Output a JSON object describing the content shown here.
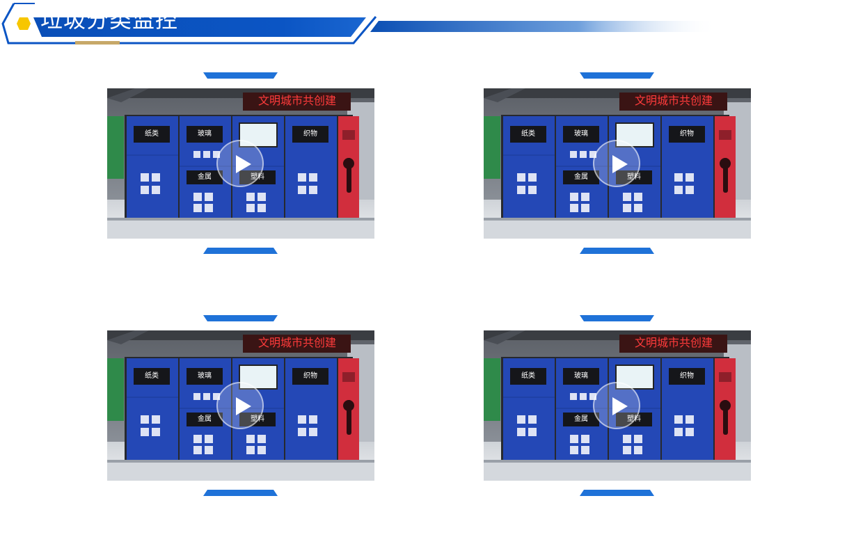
{
  "header": {
    "title": "垃圾分类监控",
    "accent_color": "#0f59c8",
    "dot_color": "#f7c600"
  },
  "videos": [
    {
      "sign": "文明城市共创建",
      "bins": [
        "纸类",
        "玻璃",
        "金属",
        "塑料",
        "织物"
      ]
    },
    {
      "sign": "文明城市共创建",
      "bins": [
        "纸类",
        "玻璃",
        "金属",
        "塑料",
        "织物"
      ]
    },
    {
      "sign": "文明城市共创建",
      "bins": [
        "纸类",
        "玻璃",
        "金属",
        "塑料",
        "织物"
      ]
    },
    {
      "sign": "文明城市共创建",
      "bins": [
        "纸类",
        "玻璃",
        "金属",
        "塑料",
        "织物"
      ]
    }
  ],
  "icons": {
    "play": "play-icon",
    "header_dot": "hexagon-dot-icon"
  }
}
